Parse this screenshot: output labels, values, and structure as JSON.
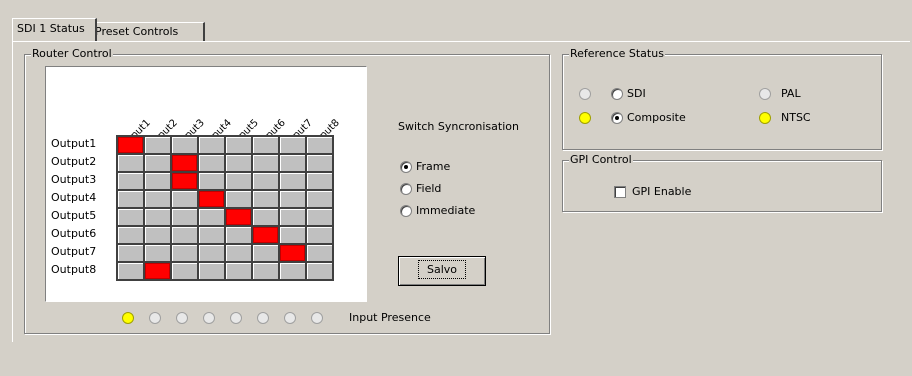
{
  "tabs": [
    {
      "label": "SDI 1 Status",
      "active": true
    },
    {
      "label": "Preset Controls",
      "active": false
    }
  ],
  "router": {
    "title": "Router Control",
    "inputs": [
      "Input1",
      "Input2",
      "Input3",
      "Input4",
      "Input5",
      "Input6",
      "Input7",
      "Input8"
    ],
    "outputs": [
      "Output1",
      "Output2",
      "Output3",
      "Output4",
      "Output5",
      "Output6",
      "Output7",
      "Output8"
    ],
    "routing": [
      1,
      3,
      3,
      4,
      5,
      6,
      7,
      2
    ],
    "input_presence_label": "Input Presence",
    "input_presence": [
      true,
      false,
      false,
      false,
      false,
      false,
      false,
      false
    ],
    "switch_sync": {
      "title": "Switch Syncronisation",
      "options": [
        "Frame",
        "Field",
        "Immediate"
      ],
      "selected": "Frame"
    },
    "salvo_label": "Salvo"
  },
  "reference_status": {
    "title": "Reference Status",
    "sdi": {
      "label": "SDI",
      "led": false,
      "checked": false
    },
    "composite": {
      "label": "Composite",
      "led": true,
      "checked": true
    },
    "pal": {
      "label": "PAL",
      "led": false
    },
    "ntsc": {
      "label": "NTSC",
      "led": true
    }
  },
  "gpi": {
    "title": "GPI Control",
    "enable_label": "GPI Enable",
    "enabled": false
  },
  "colors": {
    "route_active": "#ff0000",
    "led_on": "#ffff00",
    "background": "#d4d0c8"
  }
}
